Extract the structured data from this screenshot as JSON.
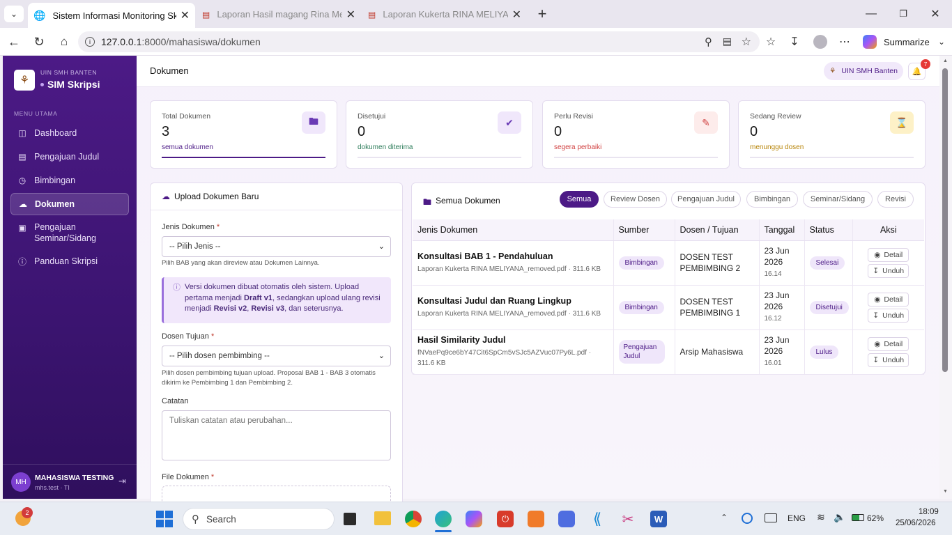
{
  "browser": {
    "tabs": [
      {
        "title": "Sistem Informasi Monitoring Skripsi",
        "active": true
      },
      {
        "title": "Laporan Hasil magang Rina Meliyana",
        "active": false
      },
      {
        "title": "Laporan Kukerta RINA MELIYANA",
        "active": false
      }
    ],
    "url_host": "127.0.0.1",
    "url_path": ":8000/mahasiswa/dokumen",
    "summarize_label": "Summarize"
  },
  "sidebar": {
    "org": "UIN SMH BANTEN",
    "app": "SIM Skripsi",
    "section": "MENU UTAMA",
    "items": [
      {
        "label": "Dashboard",
        "icon": "dashboard-icon"
      },
      {
        "label": "Pengajuan Judul",
        "icon": "document-icon"
      },
      {
        "label": "Bimbingan",
        "icon": "clock-icon"
      },
      {
        "label": "Dokumen",
        "icon": "cloud-upload-icon"
      },
      {
        "label_line1": "Pengajuan",
        "label_line2": "Seminar/Sidang",
        "icon": "presentation-icon"
      },
      {
        "label": "Panduan Skripsi",
        "icon": "info-icon"
      }
    ],
    "user": {
      "initials": "MH",
      "name": "MAHASISWA TESTING",
      "sub": "mhs.test · TI"
    }
  },
  "topbar": {
    "title": "Dokumen",
    "campus_label": "UIN SMH Banten",
    "notif_count": "7"
  },
  "stats": [
    {
      "label": "Total Dokumen",
      "value": "3",
      "sub": "semua dokumen",
      "color": "#4c1a86"
    },
    {
      "label": "Disetujui",
      "value": "0",
      "sub": "dokumen diterima",
      "color": "#2e7d5b"
    },
    {
      "label": "Perlu Revisi",
      "value": "0",
      "sub": "segera perbaiki",
      "color": "#d14343"
    },
    {
      "label": "Sedang Review",
      "value": "0",
      "sub": "menunggu dosen",
      "color": "#b8860b"
    }
  ],
  "upload": {
    "title": "Upload Dokumen Baru",
    "jenis_label": "Jenis Dokumen",
    "jenis_placeholder": "-- Pilih Jenis --",
    "jenis_help": "Pilih BAB yang akan direview atau Dokumen Lainnya.",
    "info_1": "Versi dokumen dibuat otomatis oleh sistem. Upload",
    "info_2a": "pertama menjadi ",
    "info_2b": "Draft v1",
    "info_2c": ", sedangkan upload ulang revisi",
    "info_3a": "menjadi ",
    "info_3b": "Revisi v2",
    "info_3c": ", ",
    "info_3d": "Revisi v3",
    "info_3e": ", dan seterusnya.",
    "dosen_label": "Dosen Tujuan",
    "dosen_placeholder": "-- Pilih dosen pembimbing --",
    "dosen_help_1": "Pilih dosen pembimbing tujuan upload. Proposal BAB 1 - BAB 3 otomatis",
    "dosen_help_2": "dikirim ke Pembimbing 1 dan Pembimbing 2.",
    "catatan_label": "Catatan",
    "catatan_placeholder": "Tuliskan catatan atau perubahan...",
    "file_label": "File Dokumen"
  },
  "docs": {
    "title": "Semua Dokumen",
    "filters": [
      "Semua",
      "Review Dosen",
      "Pengajuan Judul",
      "Bimbingan",
      "Seminar/Sidang",
      "Revisi"
    ],
    "columns": [
      "Jenis Dokumen",
      "Sumber",
      "Dosen / Tujuan",
      "Tanggal",
      "Status",
      "Aksi"
    ],
    "detail_label": "Detail",
    "unduh_label": "Unduh",
    "rows": [
      {
        "name": "Konsultasi BAB 1 - Pendahuluan",
        "file": "Laporan Kukerta RINA MELIYANA_removed.pdf · 311.6 KB",
        "source_1": "Bimbingan",
        "source_2": "",
        "dosen_1": "DOSEN TEST",
        "dosen_2": "PEMBIMBING 2",
        "date_1": "23 Jun",
        "date_2": "2026",
        "time": "16.14",
        "status": "Selesai"
      },
      {
        "name": "Konsultasi Judul dan Ruang Lingkup",
        "file": "Laporan Kukerta RINA MELIYANA_removed.pdf · 311.6 KB",
        "source_1": "Bimbingan",
        "source_2": "",
        "dosen_1": "DOSEN TEST",
        "dosen_2": "PEMBIMBING 1",
        "date_1": "23 Jun",
        "date_2": "2026",
        "time": "16.12",
        "status": "Disetujui"
      },
      {
        "name": "Hasil Similarity Judul",
        "file_1": "fNVaePq9ce6bY47Cit6SpCm5vSJc5AZVuc07Py6L.pdf ·",
        "file_2": "311.6 KB",
        "source_1": "Pengajuan",
        "source_2": "Judul",
        "dosen_1": "Arsip Mahasiswa",
        "dosen_2": "",
        "date_1": "23 Jun",
        "date_2": "2026",
        "time": "16.01",
        "status": "Lulus"
      }
    ]
  },
  "taskbar": {
    "search_placeholder": "Search",
    "lang": "ENG",
    "battery": "62%",
    "time": "18:09",
    "date": "25/06/2026",
    "weather_badge": "2"
  }
}
